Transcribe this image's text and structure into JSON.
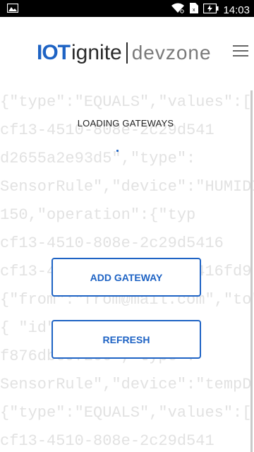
{
  "status_bar": {
    "time": "14:03",
    "icons": [
      "image-icon",
      "wifi-icon",
      "sim-card-icon",
      "battery-charging-icon"
    ]
  },
  "header": {
    "logo_iot": "IOT",
    "logo_ignite": "ignite",
    "logo_devzone": "devzone",
    "menu_icon": "hamburger-menu-icon"
  },
  "background_code_lines": [
    "{\"type\":\"EQUALS\",\"values\":[",
    "cf13-4510-808e-2c29d541",
    "d2655a2e93d5\",\"type\":",
    "SensorRule\",\"device\":\"HUMIDITY",
    "150,\"operation\":{\"typ",
    "cf13-4510-808e-2c29d5416",
    "cf13-4510-808e-2c29d5416fd9",
    "{\"from\":\"from@mail.com\",\"to\":\"to",
    "{ \"id\" : \"       \" : \"",
    "f876dbe9720c\",\"type\":",
    "SensorRule\",\"device\":\"tempD",
    "{\"type\":\"EQUALS\",\"values\":[",
    "cf13-4510-808e-2c29d541"
  ],
  "main": {
    "loading_text": "LOADING GATEWAYS",
    "add_gateway_label": "ADD GATEWAY",
    "refresh_label": "REFRESH"
  },
  "colors": {
    "brand_blue": "#1e63c4",
    "status_bar_bg": "#000000"
  }
}
